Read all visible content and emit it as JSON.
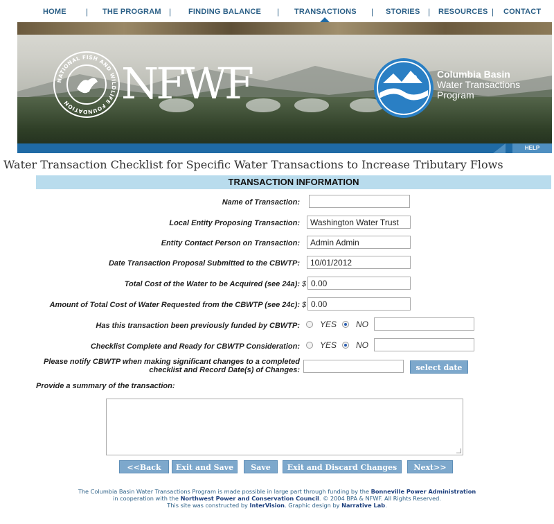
{
  "nav": {
    "items": [
      "HOME",
      "THE PROGRAM",
      "FINDING BALANCE",
      "TRANSACTIONS",
      "STORIES",
      "RESOURCES",
      "CONTACT"
    ],
    "active": "TRANSACTIONS"
  },
  "banner": {
    "nfwf_logo_text": "NFWF",
    "seal_text": "NATIONAL FISH AND WILDLIFE FOUNDATION",
    "program_line1": "Columbia Basin",
    "program_line2": "Water Transactions",
    "program_line3": "Program",
    "help_label": "HELP"
  },
  "page_title": "Water Transaction Checklist for Specific Water Transactions to Increase Tributary Flows",
  "section_header": "TRANSACTION INFORMATION",
  "form": {
    "name_label": "Name of Transaction:",
    "name_value": "",
    "entity_label": "Local Entity Proposing Transaction:",
    "entity_value": "Washington Water Trust",
    "contact_label": "Entity Contact Person on Transaction:",
    "contact_value": "Admin Admin",
    "date_label": "Date Transaction Proposal Submitted to the CBWTP:",
    "date_value": "10/01/2012",
    "total_cost_label": "Total Cost of the Water to be Acquired (see 24a):",
    "currency": "$",
    "total_cost_value": "0.00",
    "requested_label": "Amount of Total Cost of Water Requested from the CBWTP (see 24c):",
    "requested_value": "0.00",
    "funded_label": "Has this transaction been previously funded by CBWTP:",
    "checklist_label": "Checklist Complete and Ready for CBWTP Consideration:",
    "yes_label": "YES",
    "no_label": "NO",
    "funded_selected": "NO",
    "checklist_selected": "NO",
    "notify_label_line1": "Please notify CBWTP when making significant changes to a completed",
    "notify_label_line2": "checklist and Record Date(s) of Changes:",
    "select_date_label": "select date",
    "summary_label": "Provide a summary of the transaction:",
    "summary_value": ""
  },
  "buttons": {
    "back": "<<Back",
    "exit_save": "Exit and Save",
    "save": "Save",
    "exit_discard": "Exit and Discard Changes",
    "next": "Next>>"
  },
  "footer": {
    "line1_pre": "The Columbia Basin Water Transactions Program is made possible in large part through funding by the ",
    "line1_link": "Bonneville Power Administration",
    "line2_pre": "in cooperation with the ",
    "line2_link": "Northwest Power and Conservation Council",
    "line2_post": ". © 2004 BPA & NFWF. All Rights Reserved.",
    "line3_pre": "This site was constructed by ",
    "line3_link1": "InterVision",
    "line3_mid": ". Graphic design by ",
    "line3_link2": "Narrative Lab",
    "line3_post": "."
  },
  "colors": {
    "nav_text": "#2b5f86",
    "blue_bar": "#1f6aa5",
    "section_bg": "#b9dced",
    "button_bg": "#7da8cc"
  }
}
